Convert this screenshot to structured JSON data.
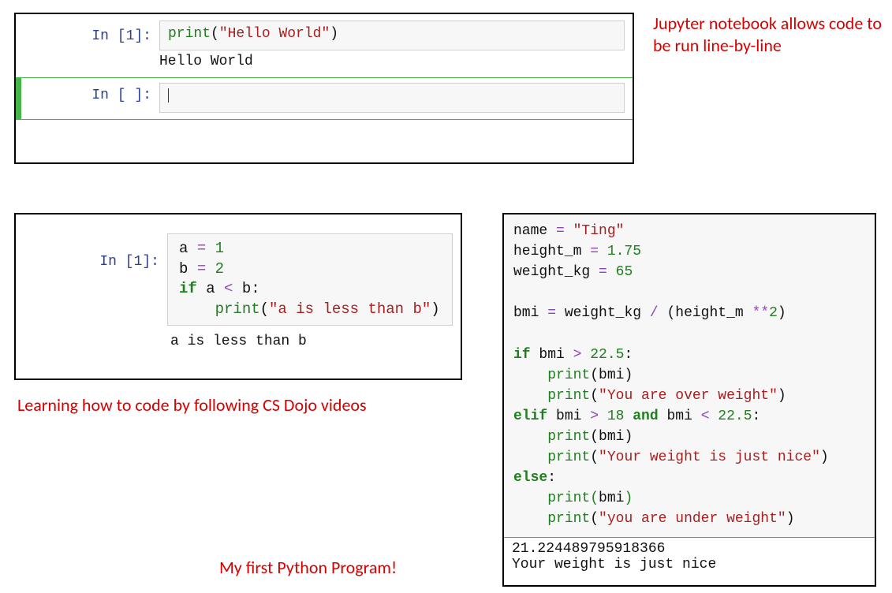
{
  "annotations": {
    "topRight": "Jupyter notebook allows code to be run line-by-line",
    "midLeft": "Learning how to code by following CS Dojo videos",
    "bottomCenter": "My first Python Program!"
  },
  "panel1": {
    "cell1": {
      "prompt": "In [1]:",
      "code": {
        "fn": "print",
        "lpar": "(",
        "str": "\"Hello World\"",
        "rpar": ")"
      },
      "output": "Hello World"
    },
    "cell2": {
      "prompt": "In [ ]:"
    }
  },
  "panel2": {
    "cell": {
      "prompt": "In [1]:",
      "l1_a": "a ",
      "l1_eq": "= ",
      "l1_v": "1",
      "l2_a": "b ",
      "l2_eq": "= ",
      "l2_v": "2",
      "l3_if": "if ",
      "l3_a": "a ",
      "l3_lt": "< ",
      "l3_b": "b:",
      "l4_sp": "    ",
      "l4_fn": "print",
      "l4_lp": "(",
      "l4_str": "\"a is less than b\"",
      "l4_rp": ")",
      "output": "a is less than b"
    }
  },
  "panel3": {
    "l1_a": "name ",
    "l1_eq": "= ",
    "l1_v": "\"Ting\"",
    "l2_a": "height_m ",
    "l2_eq": "= ",
    "l2_v": "1.75",
    "l3_a": "weight_kg ",
    "l3_eq": "= ",
    "l3_v": "65",
    "blank": "",
    "l5_a": "bmi ",
    "l5_eq": "= ",
    "l5_b": "weight_kg ",
    "l5_div": "/ ",
    "l5_c": "(height_m ",
    "l5_pow": "**",
    "l5_d": "2",
    "l5_e": ")",
    "l7_if": "if ",
    "l7_a": "bmi ",
    "l7_gt": "> ",
    "l7_v": "22.5",
    "l7_col": ":",
    "l8_sp": "    ",
    "l8_fn": "print",
    "l8_lp": "(",
    "l8_arg": "bmi",
    "l8_rp": ")",
    "l9_sp": "    ",
    "l9_fn": "print",
    "l9_lp": "(",
    "l9_str": "\"You are over weight\"",
    "l9_rp": ")",
    "l10_elif": "elif ",
    "l10_a": "bmi ",
    "l10_gt": "> ",
    "l10_v1": "18 ",
    "l10_and": "and ",
    "l10_b": "bmi ",
    "l10_lt": "< ",
    "l10_v2": "22.5",
    "l10_col": ":",
    "l11_sp": "    ",
    "l11_fn": "print",
    "l11_lp": "(",
    "l11_arg": "bmi",
    "l11_rp": ")",
    "l12_sp": "    ",
    "l12_fn": "print",
    "l12_lp": "(",
    "l12_str": "\"Your weight is just nice\"",
    "l12_rp": ")",
    "l13_else": "else",
    "l13_col": ":",
    "l14_sp": "    ",
    "l14_fn": "print",
    "l14_lp": "(",
    "l14_arg": "bmi",
    "l14_rp": ")",
    "l15_sp": "    ",
    "l15_fn": "print",
    "l15_lp": "(",
    "l15_str": "\"you are under weight\"",
    "l15_rp": ")",
    "output": "21.224489795918366\nYour weight is just nice"
  }
}
